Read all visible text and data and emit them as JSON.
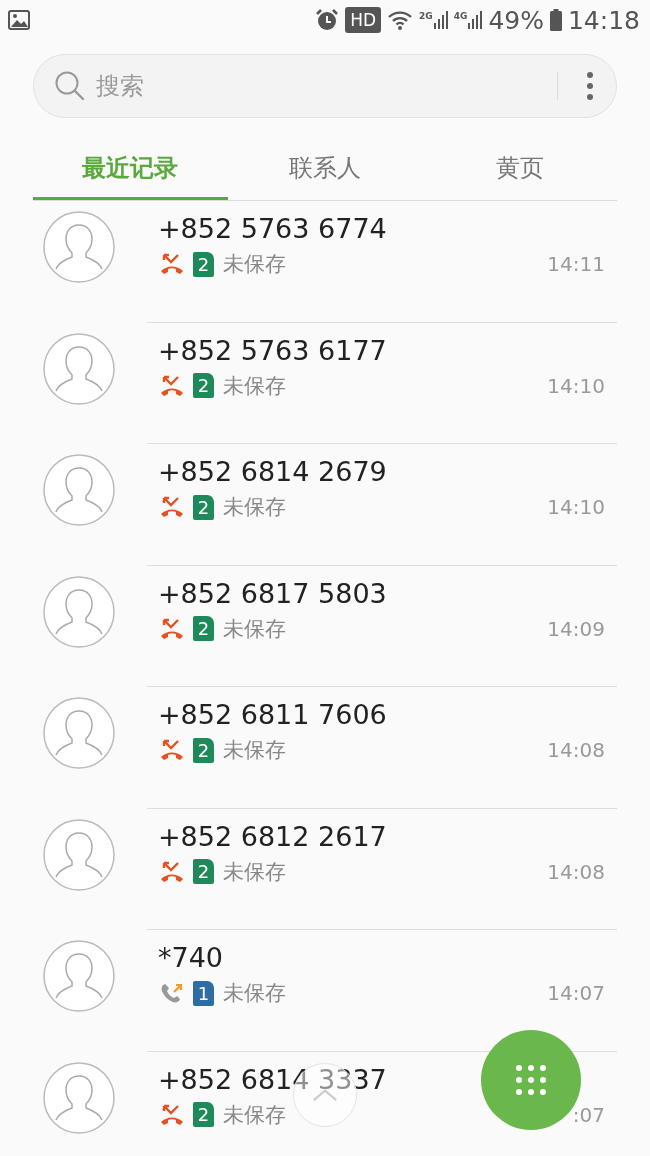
{
  "status_bar": {
    "hd": "HD",
    "sim1_network": "2G",
    "sim2_network": "4G",
    "battery": "49%",
    "time": "14:18"
  },
  "search": {
    "placeholder": "搜索"
  },
  "tabs": [
    {
      "label": "最近记录",
      "selected": true
    },
    {
      "label": "联系人",
      "selected": false
    },
    {
      "label": "黄页",
      "selected": false
    }
  ],
  "calls": [
    {
      "number": "+852 5763 6774",
      "kind": "missed",
      "sim": "2",
      "color": "#1e8a5a",
      "status": "未保存",
      "time": "14:11"
    },
    {
      "number": "+852 5763 6177",
      "kind": "missed",
      "sim": "2",
      "color": "#1e8a5a",
      "status": "未保存",
      "time": "14:10"
    },
    {
      "number": "+852 6814 2679",
      "kind": "missed",
      "sim": "2",
      "color": "#1e8a5a",
      "status": "未保存",
      "time": "14:10"
    },
    {
      "number": "+852 6817 5803",
      "kind": "missed",
      "sim": "2",
      "color": "#1e8a5a",
      "status": "未保存",
      "time": "14:09"
    },
    {
      "number": "+852 6811 7606",
      "kind": "missed",
      "sim": "2",
      "color": "#1e8a5a",
      "status": "未保存",
      "time": "14:08"
    },
    {
      "number": "+852 6812 2617",
      "kind": "missed",
      "sim": "2",
      "color": "#1e8a5a",
      "status": "未保存",
      "time": "14:08"
    },
    {
      "number": "*740",
      "kind": "outgoing",
      "sim": "1",
      "color": "#2e6da4",
      "status": "未保存",
      "time": "14:07"
    },
    {
      "number": "+852 6814 3337",
      "kind": "missed",
      "sim": "2",
      "color": "#1e8a5a",
      "status": "未保存",
      "time": ":07"
    }
  ]
}
